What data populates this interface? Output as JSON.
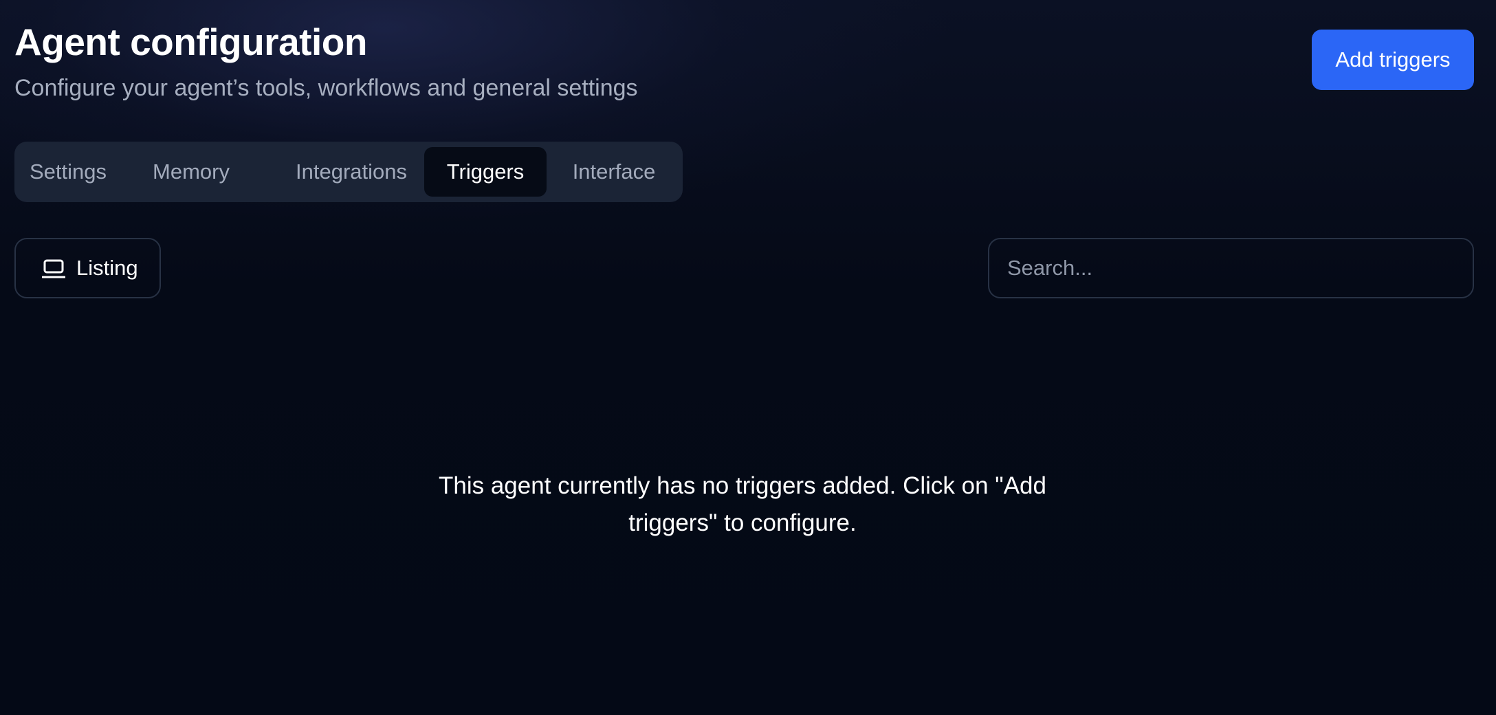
{
  "header": {
    "title": "Agent configuration",
    "subtitle": "Configure your agent’s tools, workflows and general settings",
    "add_triggers_label": "Add triggers"
  },
  "tabs": [
    {
      "label": "Settings",
      "active": false
    },
    {
      "label": "Memory",
      "active": false
    },
    {
      "label": "Integrations",
      "active": false
    },
    {
      "label": "Triggers",
      "active": true
    },
    {
      "label": "Interface",
      "active": false
    }
  ],
  "toolbar": {
    "listing_label": "Listing",
    "listing_icon": "laptop-icon",
    "search_value": "",
    "search_placeholder": "Search..."
  },
  "empty_state": {
    "message": "This agent currently has no triggers added. Click on \"Add triggers\" to configure."
  },
  "colors": {
    "background": "#050a17",
    "accent": "#2b66f6",
    "tab_bar": "#1b2436",
    "active_tab": "#060b16",
    "muted_text": "#a7afc0"
  }
}
